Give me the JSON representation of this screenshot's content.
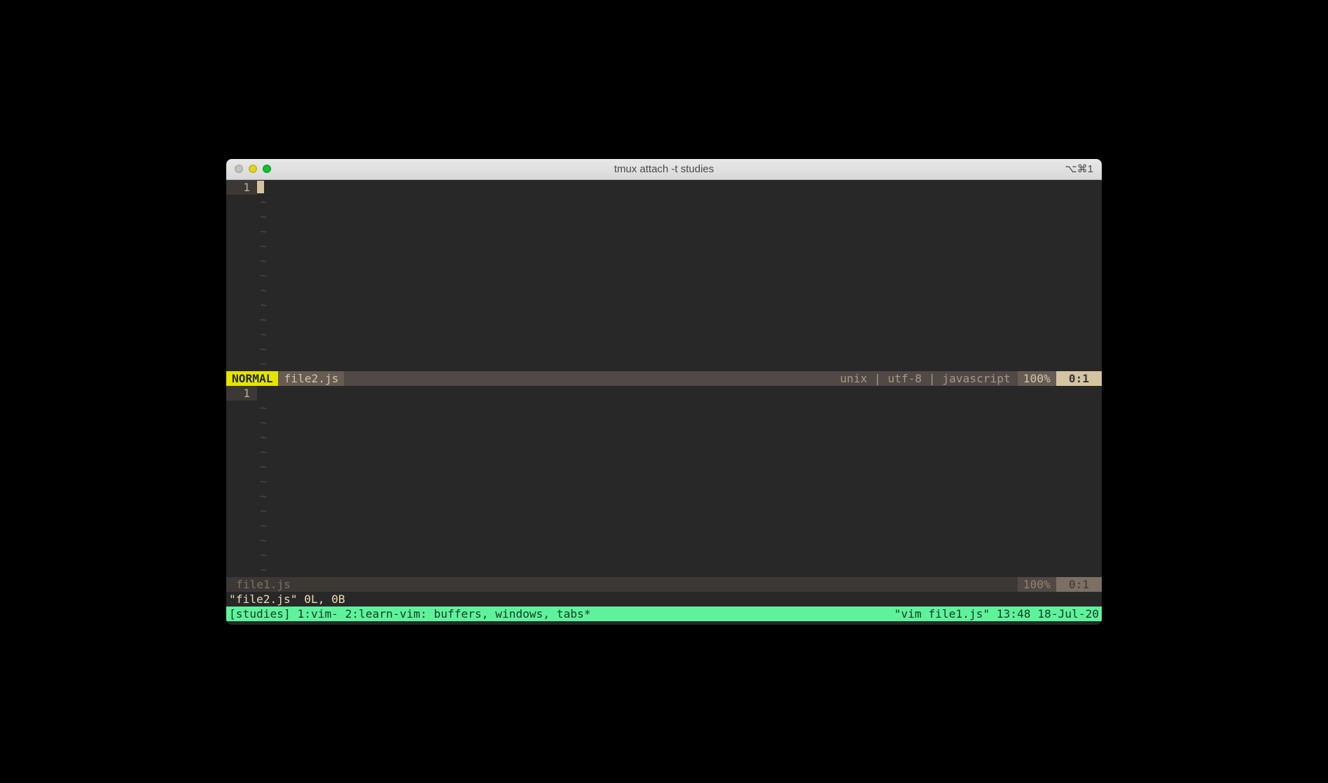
{
  "window": {
    "title": "tmux attach -t studies",
    "shortcut": "⌥⌘1"
  },
  "pane_top": {
    "line_number": "1",
    "tilde": "~",
    "status": {
      "mode": "NORMAL",
      "filename": "file2.js",
      "info": "unix | utf-8 | javascript",
      "percent": "100%",
      "pos": "0:1"
    }
  },
  "pane_bottom": {
    "line_number": "1",
    "tilde": "~",
    "status": {
      "filename": "file1.js",
      "percent": "100%",
      "pos": "0:1"
    }
  },
  "message": "\"file2.js\" 0L, 0B",
  "tmux": {
    "left": "[studies] 1:vim- 2:learn-vim: buffers, windows, tabs*",
    "right": "\"vim file1.js\" 13:48 18-Jul-20"
  }
}
